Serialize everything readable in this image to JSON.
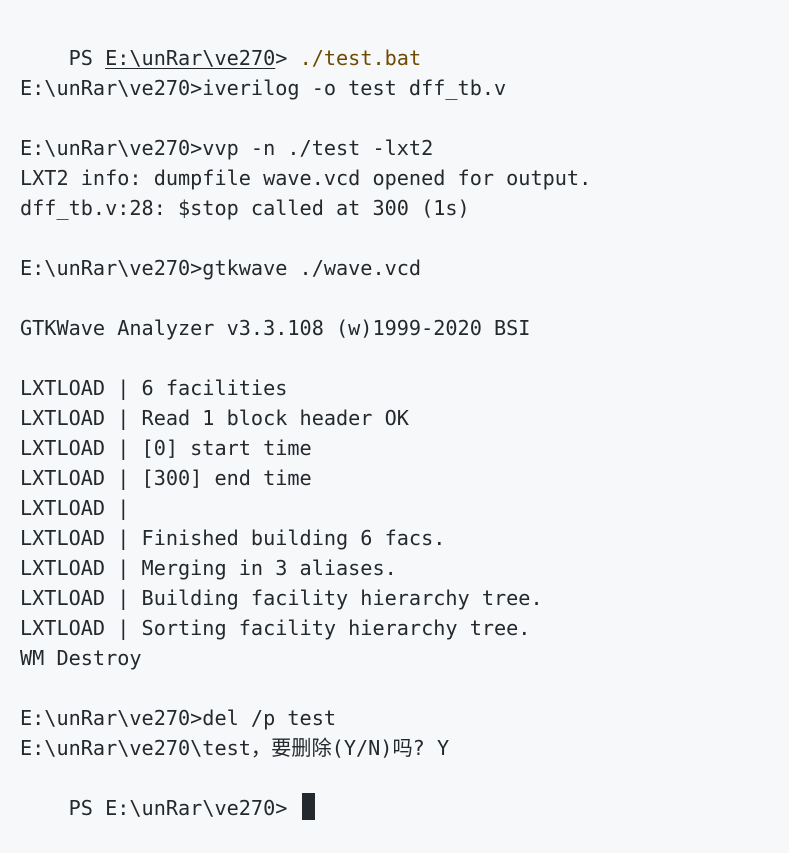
{
  "colors": {
    "background": "#f6f8fa",
    "text": "#24292e",
    "command_accent": "#6f4a00"
  },
  "terminal": {
    "first_prompt": {
      "ps_prefix": "PS ",
      "path": "E:\\unRar\\ve270",
      "suffix": "> ",
      "command": "./test.bat"
    },
    "lines": {
      "l2": "E:\\unRar\\ve270>iverilog -o test dff_tb.v",
      "l4": "E:\\unRar\\ve270>vvp -n ./test -lxt2",
      "l5": "LXT2 info: dumpfile wave.vcd opened for output.",
      "l6": "dff_tb.v:28: $stop called at 300 (1s)",
      "l8": "E:\\unRar\\ve270>gtkwave ./wave.vcd",
      "l10": "GTKWave Analyzer v3.3.108 (w)1999-2020 BSI",
      "l12": "LXTLOAD | 6 facilities",
      "l13": "LXTLOAD | Read 1 block header OK",
      "l14": "LXTLOAD | [0] start time",
      "l15": "LXTLOAD | [300] end time",
      "l16": "LXTLOAD |",
      "l17": "LXTLOAD | Finished building 6 facs.",
      "l18": "LXTLOAD | Merging in 3 aliases.",
      "l19": "LXTLOAD | Building facility hierarchy tree.",
      "l20": "LXTLOAD | Sorting facility hierarchy tree.",
      "l21": "WM Destroy",
      "l23": "E:\\unRar\\ve270>del /p test",
      "l24": "E:\\unRar\\ve270\\test，要删除(Y/N)吗? Y",
      "l25": "PS E:\\unRar\\ve270> "
    }
  }
}
